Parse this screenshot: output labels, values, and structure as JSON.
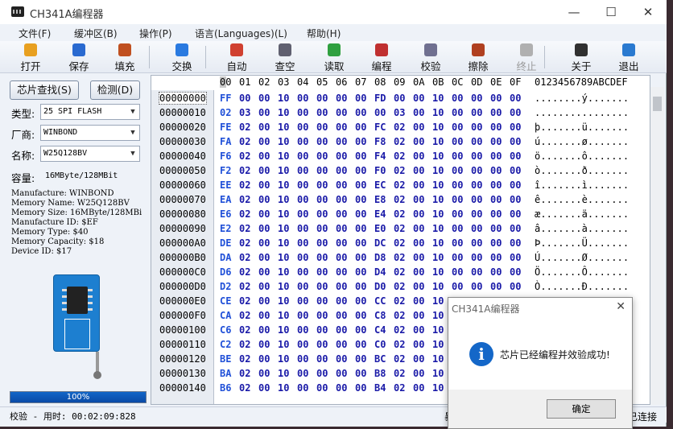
{
  "window": {
    "title": "CH341A编程器"
  },
  "window_controls": {
    "minimize": "—",
    "maximize": "☐",
    "close": "✕"
  },
  "menu": [
    {
      "label": "文件(F)"
    },
    {
      "label": "缓冲区(B)"
    },
    {
      "label": "操作(P)"
    },
    {
      "label": "语言(Languages)(L)"
    },
    {
      "label": "帮助(H)"
    }
  ],
  "toolbar": [
    {
      "label": "打开",
      "icon": "open-folder-icon",
      "color": "#e8a020",
      "enabled": true
    },
    {
      "label": "保存",
      "icon": "save-disk-icon",
      "color": "#2a6ad0",
      "enabled": true
    },
    {
      "label": "填充",
      "icon": "fill-pencil-icon",
      "color": "#c05020",
      "enabled": true
    },
    {
      "label": "交换",
      "icon": "swap-arrows-icon",
      "color": "#2a7ae0",
      "enabled": true
    },
    {
      "label": "自动",
      "icon": "auto-run-icon",
      "color": "#d04030",
      "enabled": true
    },
    {
      "label": "查空",
      "icon": "blank-check-icon",
      "color": "#606070",
      "enabled": true
    },
    {
      "label": "读取",
      "icon": "read-icon",
      "color": "#30a040",
      "enabled": true
    },
    {
      "label": "编程",
      "icon": "program-icon",
      "color": "#c03030",
      "enabled": true
    },
    {
      "label": "校验",
      "icon": "verify-icon",
      "color": "#707090",
      "enabled": true
    },
    {
      "label": "擦除",
      "icon": "erase-icon",
      "color": "#b04020",
      "enabled": true
    },
    {
      "label": "终止",
      "icon": "stop-icon",
      "color": "#b0b0b0",
      "enabled": false
    },
    {
      "label": "关于",
      "icon": "about-info-icon",
      "color": "#303030",
      "enabled": true
    },
    {
      "label": "退出",
      "icon": "exit-door-icon",
      "color": "#2a7ad0",
      "enabled": true
    }
  ],
  "left": {
    "detect_button": "芯片查找(S)",
    "check_button": "检测(D)",
    "type_label": "类型:",
    "type_value": "25 SPI FLASH",
    "vendor_label": "厂商:",
    "vendor_value": "WINBOND",
    "name_label": "名称:",
    "name_value": "W25Q128BV",
    "capacity_label": "容量:",
    "capacity_value": "16MByte/128MBit",
    "info": [
      "Manufacture: WINBOND",
      "Memory Name: W25Q128BV",
      "Memory Size: 16MByte/128MBi",
      "Manufacture ID: $EF",
      "Memory Type: $40",
      "Memory Capacity: $18",
      "Device ID: $17"
    ],
    "progress_fraction": 1.0,
    "progress_text": "100%"
  },
  "hex": {
    "header_cols": [
      "00",
      "01",
      "02",
      "03",
      "04",
      "05",
      "06",
      "07",
      "08",
      "09",
      "0A",
      "0B",
      "0C",
      "0D",
      "0E",
      "0F"
    ],
    "ascii_header": "0123456789ABCDEF",
    "rows": [
      {
        "off": "00000000",
        "bytes": "FF 00 00 10 00 00 00 00 FD 00 00 10 00 00 00 00",
        "ascii": "........ý.......",
        "selected": true
      },
      {
        "off": "00000010",
        "bytes": "02 03 00 10 00 00 00 00 00 03 00 10 00 00 00 00",
        "ascii": "................"
      },
      {
        "off": "00000020",
        "bytes": "FE 02 00 10 00 00 00 00 FC 02 00 10 00 00 00 00",
        "ascii": "þ.......ü......."
      },
      {
        "off": "00000030",
        "bytes": "FA 02 00 10 00 00 00 00 F8 02 00 10 00 00 00 00",
        "ascii": "ú.......ø......."
      },
      {
        "off": "00000040",
        "bytes": "F6 02 00 10 00 00 00 00 F4 02 00 10 00 00 00 00",
        "ascii": "ö.......ô......."
      },
      {
        "off": "00000050",
        "bytes": "F2 02 00 10 00 00 00 00 F0 02 00 10 00 00 00 00",
        "ascii": "ò.......ð......."
      },
      {
        "off": "00000060",
        "bytes": "EE 02 00 10 00 00 00 00 EC 02 00 10 00 00 00 00",
        "ascii": "î.......ì......."
      },
      {
        "off": "00000070",
        "bytes": "EA 02 00 10 00 00 00 00 E8 02 00 10 00 00 00 00",
        "ascii": "ê.......è......."
      },
      {
        "off": "00000080",
        "bytes": "E6 02 00 10 00 00 00 00 E4 02 00 10 00 00 00 00",
        "ascii": "æ.......ä......."
      },
      {
        "off": "00000090",
        "bytes": "E2 02 00 10 00 00 00 00 E0 02 00 10 00 00 00 00",
        "ascii": "â.......à......."
      },
      {
        "off": "000000A0",
        "bytes": "DE 02 00 10 00 00 00 00 DC 02 00 10 00 00 00 00",
        "ascii": "Þ.......Ü......."
      },
      {
        "off": "000000B0",
        "bytes": "DA 02 00 10 00 00 00 00 D8 02 00 10 00 00 00 00",
        "ascii": "Ú.......Ø......."
      },
      {
        "off": "000000C0",
        "bytes": "D6 02 00 10 00 00 00 00 D4 02 00 10 00 00 00 00",
        "ascii": "Ö.......Ô......."
      },
      {
        "off": "000000D0",
        "bytes": "D2 02 00 10 00 00 00 00 D0 02 00 10 00 00 00 00",
        "ascii": "Ò.......Ð......."
      },
      {
        "off": "000000E0",
        "bytes": "CE 02 00 10 00 00 00 00 CC 02 00 10",
        "ascii": ""
      },
      {
        "off": "000000F0",
        "bytes": "CA 02 00 10 00 00 00 00 C8 02 00 10",
        "ascii": ""
      },
      {
        "off": "00000100",
        "bytes": "C6 02 00 10 00 00 00 00 C4 02 00 10",
        "ascii": ""
      },
      {
        "off": "00000110",
        "bytes": "C2 02 00 10 00 00 00 00 C0 02 00 10",
        "ascii": ""
      },
      {
        "off": "00000120",
        "bytes": "BE 02 00 10 00 00 00 00 BC 02 00 10",
        "ascii": ""
      },
      {
        "off": "00000130",
        "bytes": "BA 02 00 10 00 00 00 00 B8 02 00 10",
        "ascii": ""
      },
      {
        "off": "00000140",
        "bytes": "B6 02 00 10 00 00 00 00 B4 02 00 10",
        "ascii": ""
      }
    ]
  },
  "status": {
    "text": "校验 - 用时: 00:02:09:828",
    "mid": "暴",
    "right": "已连接"
  },
  "dialog": {
    "title": "CH341A编程器",
    "close": "✕",
    "icon": "information-icon",
    "icon_glyph": "i",
    "message": "芯片已经编程并效验成功!",
    "ok": "确定"
  }
}
